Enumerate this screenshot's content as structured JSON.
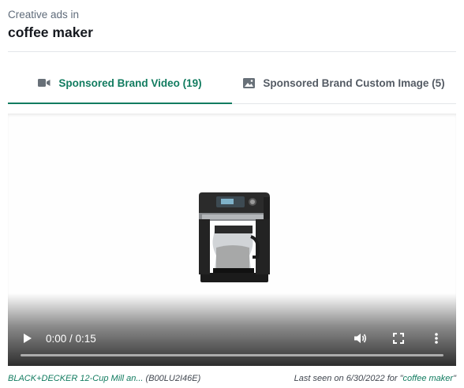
{
  "header": {
    "subtitle": "Creative ads in",
    "keyword": "coffee maker"
  },
  "tabs": [
    {
      "label": "Sponsored Brand Video (19)",
      "icon": "video-camera-icon",
      "active": true
    },
    {
      "label": "Sponsored Brand Custom Image (5)",
      "icon": "image-icon",
      "active": false
    }
  ],
  "player": {
    "time": "0:00 / 0:15",
    "progress": 0
  },
  "footer": {
    "product_name": "BLACK+DECKER 12-Cup Mill an...",
    "asin": "(B00LU2I46E)",
    "last_seen_prefix": "Last seen on 6/30/2022 for \"",
    "last_seen_keyword": "coffee maker",
    "last_seen_suffix": "\""
  },
  "colors": {
    "accent": "#127c60",
    "muted": "#545b64"
  }
}
